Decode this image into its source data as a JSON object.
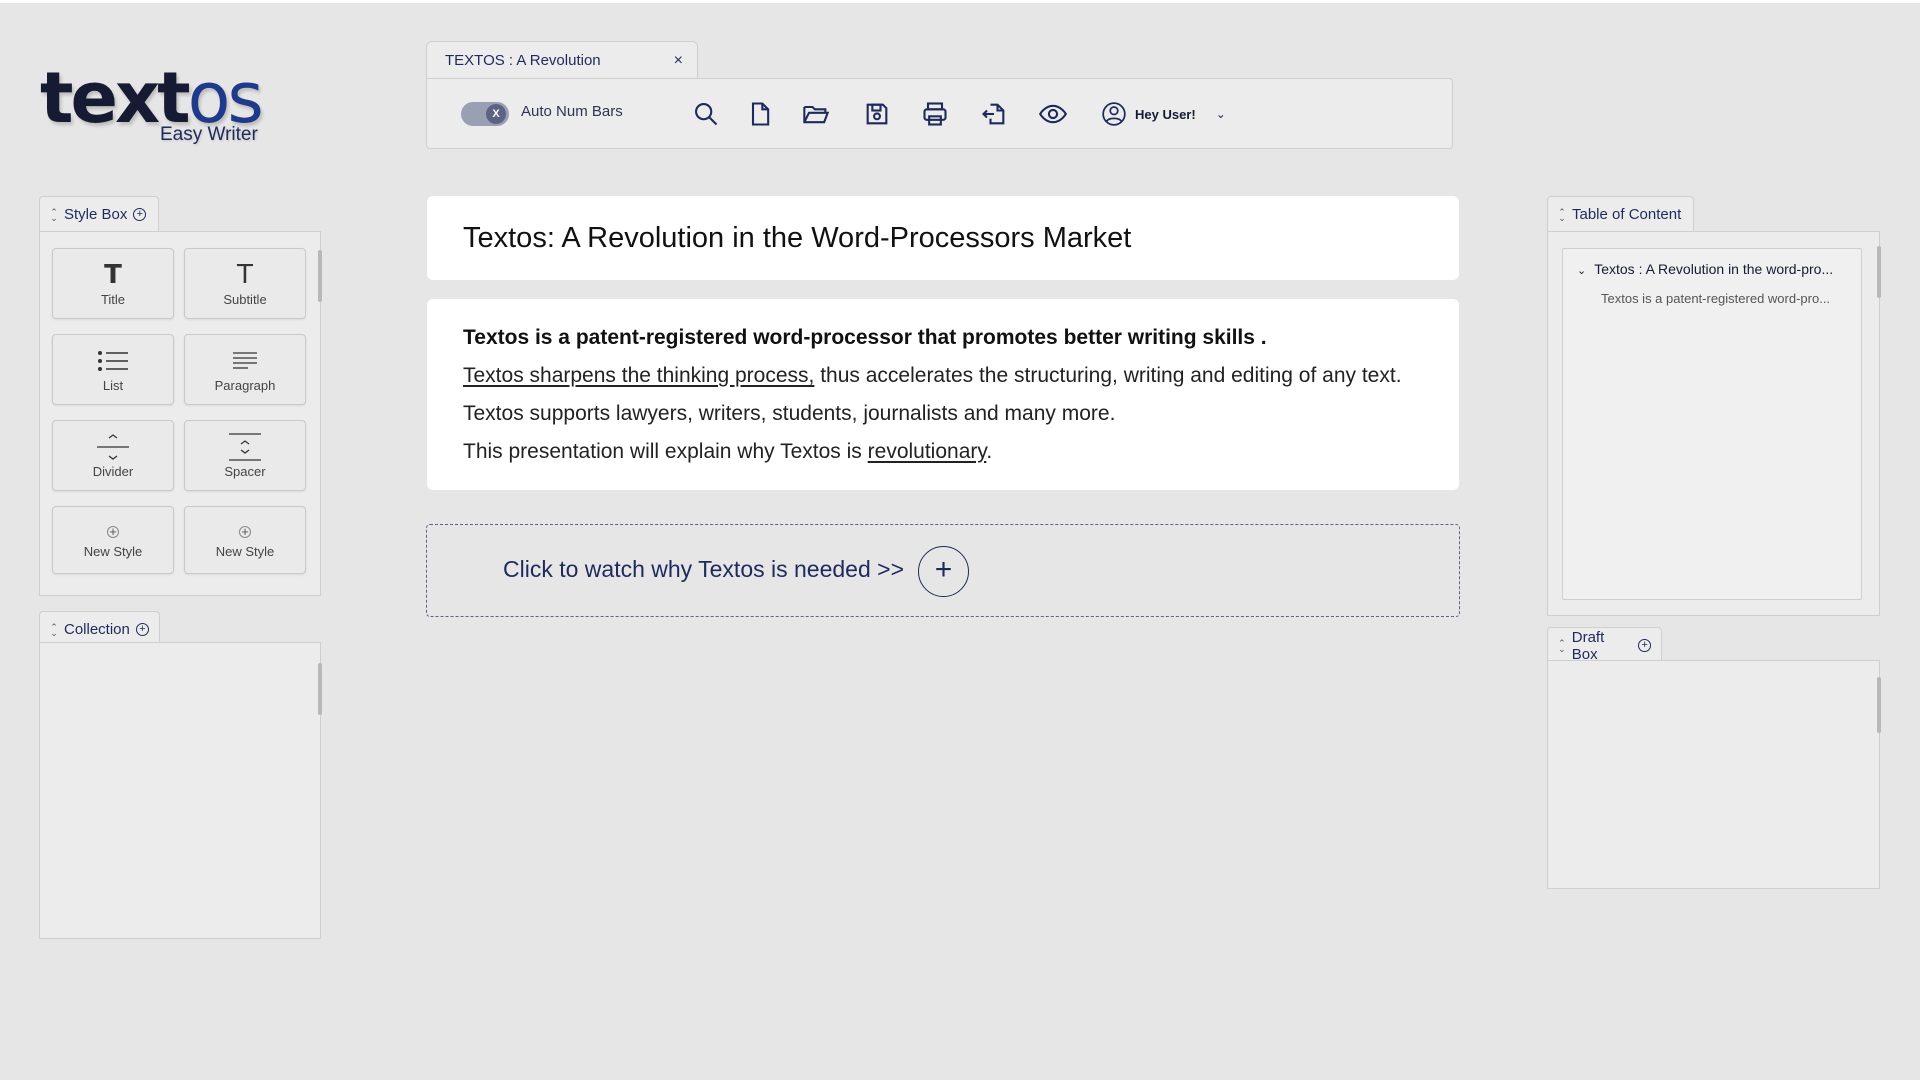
{
  "logo": {
    "word_dark": "text",
    "word_accent": "os",
    "subtitle": "Easy Writer"
  },
  "document_tab": {
    "title": "TEXTOS : A Revolution",
    "close": "×"
  },
  "toolbar": {
    "toggle_knob": "X",
    "toggle_label": "Auto Num Bars",
    "icons": [
      "search-icon",
      "new-file-icon",
      "open-folder-icon",
      "save-icon",
      "print-icon",
      "export-icon",
      "preview-eye-icon"
    ],
    "user_label": "Hey User!"
  },
  "style_box": {
    "title": "Style Box",
    "tiles": [
      {
        "label": "Title",
        "glyph": "T"
      },
      {
        "label": "Subtitle",
        "glyph": "T"
      },
      {
        "label": "List"
      },
      {
        "label": "Paragraph"
      },
      {
        "label": "Divider"
      },
      {
        "label": "Spacer"
      },
      {
        "label": "New Style"
      },
      {
        "label": "New Style"
      }
    ]
  },
  "collection": {
    "title": "Collection"
  },
  "document": {
    "title": "Textos:  A Revolution in the Word-Processors Market",
    "line1": "Textos is a patent-registered word-processor that promotes better writing skills .",
    "line2_link": "Textos sharpens the thinking process,",
    "line2_rest": " thus accelerates the structuring, writing and editing of any text.",
    "line3": "Textos supports lawyers, writers, students, journalists and many more.",
    "line4_pre": "This presentation will explain why Textos is ",
    "line4_link": "revolutionary",
    "line4_post": "."
  },
  "watch": {
    "text": "Click to watch why Textos is needed >>",
    "plus": "+"
  },
  "toc": {
    "title": "Table of Content",
    "heading": "Textos : A Revolution in the word-pro...",
    "sub": "Textos is a patent-registered word-pro..."
  },
  "draft_box": {
    "title": "Draft Box"
  },
  "colors": {
    "background": "#e6e6e6",
    "accent": "#1f2a5c",
    "card": "#ffffff"
  }
}
